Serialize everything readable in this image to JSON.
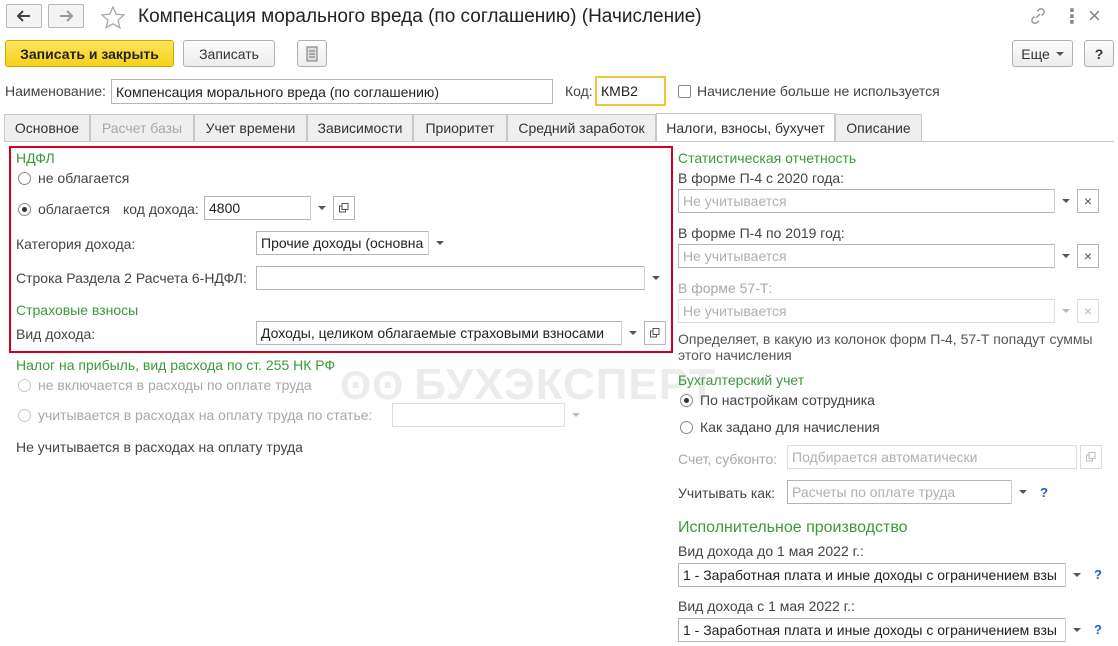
{
  "window": {
    "title": "Компенсация морального вреда (по соглашению) (Начисление)"
  },
  "toolbar": {
    "save_close_label": "Записать и закрыть",
    "save_label": "Записать",
    "more_label": "Еще",
    "help_label": "?"
  },
  "header": {
    "name_label": "Наименование:",
    "name_value": "Компенсация морального вреда (по соглашению)",
    "code_label": "Код:",
    "code_value": "КМВ2",
    "not_used_label": "Начисление больше не используется"
  },
  "tabs": [
    {
      "label": "Основное"
    },
    {
      "label": "Расчет базы"
    },
    {
      "label": "Учет времени"
    },
    {
      "label": "Зависимости"
    },
    {
      "label": "Приоритет"
    },
    {
      "label": "Средний заработок"
    },
    {
      "label": "Налоги, взносы, бухучет"
    },
    {
      "label": "Описание"
    }
  ],
  "ndfl": {
    "section_title": "НДФЛ",
    "not_taxed_label": "не облагается",
    "taxed_label": "облагается",
    "income_code_label": "код дохода:",
    "income_code_value": "4800",
    "income_category_label": "Категория дохода:",
    "income_category_value": "Прочие доходы (основна",
    "section2_label": "Строка Раздела 2 Расчета 6-НДФЛ:",
    "section2_value": ""
  },
  "insurance": {
    "section_title": "Страховые взносы",
    "income_type_label": "Вид дохода:",
    "income_type_value": "Доходы, целиком облагаемые страховыми взносами"
  },
  "profit_tax": {
    "section_title": "Налог на прибыль, вид расхода по ст. 255 НК РФ",
    "not_included_label": "не включается в расходы по оплате труда",
    "included_label": "учитывается в расходах на оплату труда по статье:",
    "note": "Не учитывается в расходах на оплату труда"
  },
  "stat": {
    "section_title": "Статистическая отчетность",
    "p4_2020_label": "В форме П-4 с 2020 года:",
    "p4_2020_placeholder": "Не учитывается",
    "p4_2019_label": "В форме П-4 по 2019 год:",
    "p4_2019_placeholder": "Не учитывается",
    "f57_label": "В форме 57-Т:",
    "f57_placeholder": "Не учитывается",
    "note_line1": "Определяет, в какую из колонок форм П-4, 57-Т попадут суммы",
    "note_line2": "этого начисления"
  },
  "accounting": {
    "section_title": "Бухгалтерский учет",
    "by_employee_label": "По настройкам сотрудника",
    "as_accrual_label": "Как задано для начисления",
    "account_label": "Счет, субконто:",
    "account_placeholder": "Подбирается автоматически",
    "consider_as_label": "Учитывать как:",
    "consider_as_placeholder": "Расчеты по оплате труда",
    "help_mark": "?"
  },
  "enforcement": {
    "section_title": "Исполнительное производство",
    "before_label": "Вид дохода до 1 мая 2022 г.:",
    "before_value": "1 - Заработная плата и иные доходы с ограничением взы",
    "after_label": "Вид дохода с 1 мая 2022 г.:",
    "after_value": "1 - Заработная плата и иные доходы с ограничением взы",
    "help_mark": "?"
  },
  "watermark": {
    "text": "БУХЭКСПЕРТ"
  },
  "colors": {
    "accent_yellow": "#f5d21a",
    "section_green": "#3a9a3a",
    "highlight_red": "#d0021b",
    "help_blue": "#1f5fc8"
  }
}
